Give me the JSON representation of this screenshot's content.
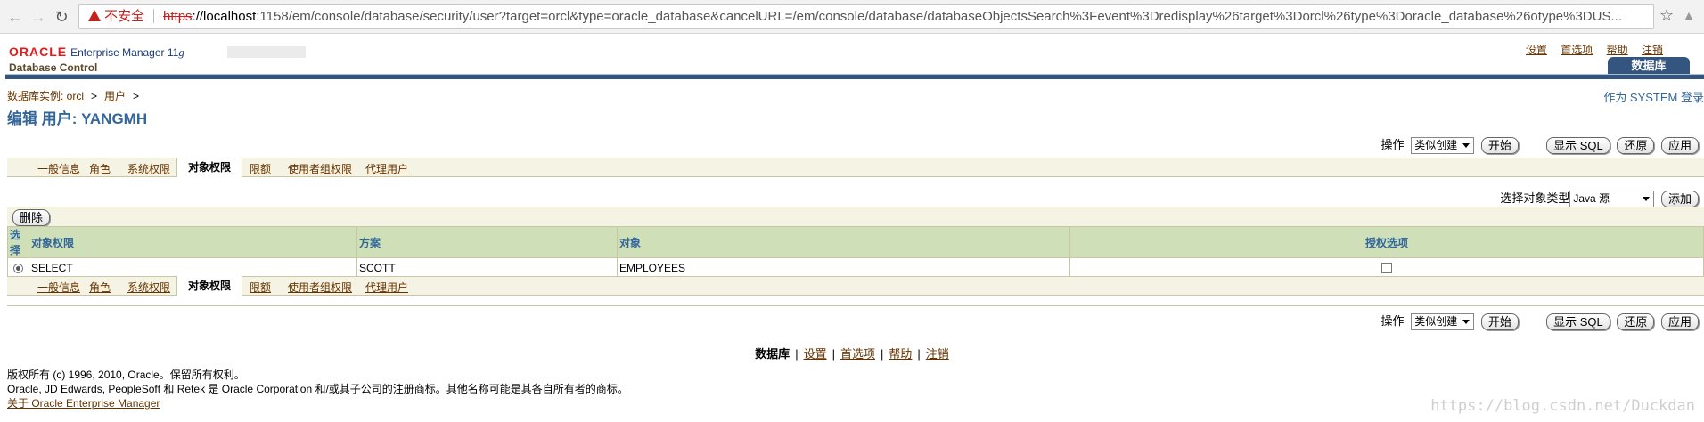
{
  "browser": {
    "security_label": "不安全",
    "url_scheme": "https",
    "url_host": "://localhost",
    "url_rest": ":1158/em/console/database/security/user?target=orcl&type=oracle_database&cancelURL=/em/console/database/databaseObjectsSearch%3Fevent%3Dredisplay%26target%3Dorcl%26type%3Doracle_database%26otype%3DUS..."
  },
  "header": {
    "oracle": "ORACLE",
    "product": "Enterprise Manager 11",
    "product_suffix": "g",
    "subtitle": "Database Control",
    "links": [
      "设置",
      "首选项",
      "帮助",
      "注销"
    ],
    "db_tab": "数据库",
    "login_as": "作为 SYSTEM 登录"
  },
  "breadcrumb": {
    "items": [
      "数据库实例: orcl",
      "用户"
    ],
    "separator": ">"
  },
  "page": {
    "title": "编辑 用户: YANGMH"
  },
  "actions": {
    "label": "操作",
    "select_value": "类似创建",
    "go": "开始",
    "show_sql": "显示 SQL",
    "revert": "还原",
    "apply": "应用"
  },
  "tabs": [
    {
      "label": "一般信息",
      "selected": false
    },
    {
      "label": "角色",
      "selected": false
    },
    {
      "label": "系统权限",
      "selected": false
    },
    {
      "label": "对象权限",
      "selected": true
    },
    {
      "label": "限额",
      "selected": false
    },
    {
      "label": "使用者组权限",
      "selected": false
    },
    {
      "label": "代理用户",
      "selected": false
    }
  ],
  "object_type": {
    "label": "选择对象类型",
    "value": "Java 源",
    "add": "添加"
  },
  "table": {
    "delete_button": "删除",
    "columns": [
      "选择",
      "对象权限",
      "方案",
      "对象",
      "授权选项"
    ],
    "rows": [
      {
        "privilege": "SELECT",
        "schema": "SCOTT",
        "object": "EMPLOYEES",
        "grant_option": false
      }
    ]
  },
  "footer": {
    "current": "数据库",
    "links": [
      "设置",
      "首选项",
      "帮助",
      "注销"
    ],
    "copyright1": "版权所有 (c) 1996, 2010, Oracle。保留所有权利。",
    "copyright2": "Oracle, JD Edwards, PeopleSoft 和 Retek 是 Oracle Corporation 和/或其子公司的注册商标。其他名称可能是其各自所有者的商标。",
    "about": "关于 Oracle Enterprise Manager"
  },
  "watermark": "https://blog.csdn.net/Duckdan",
  "colors": {
    "accent": "#336699",
    "header_bar": "#33557f",
    "link": "#663300",
    "oracle_red": "#e21a1a",
    "table_header": "#cfe0b8",
    "tab_bg": "#f5f3e3"
  }
}
